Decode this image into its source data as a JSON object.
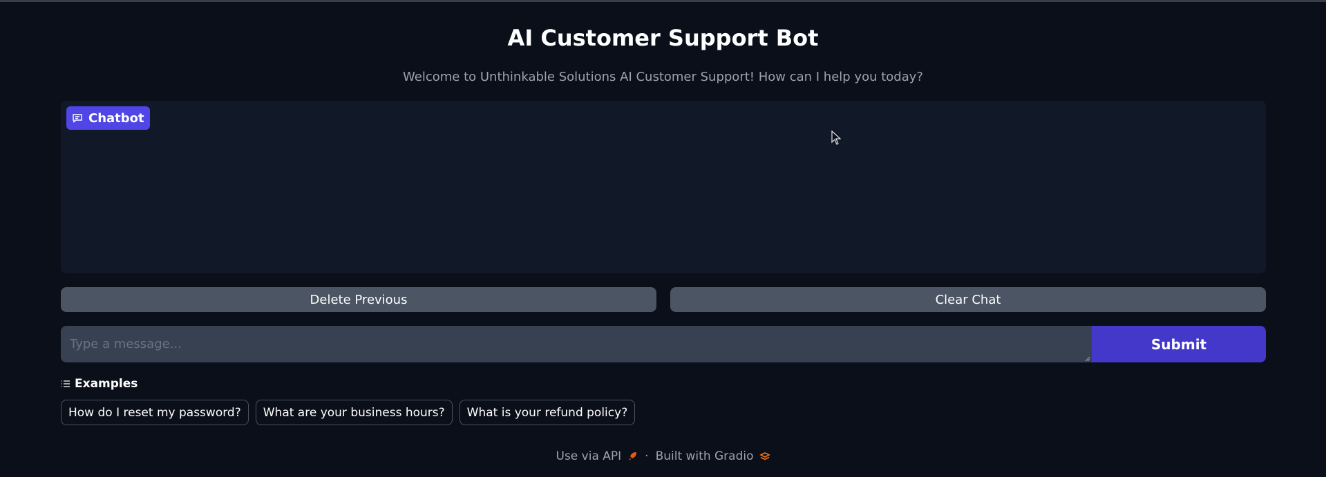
{
  "header": {
    "title": "AI Customer Support Bot",
    "subtitle": "Welcome to Unthinkable Solutions AI Customer Support! How can I help you today?"
  },
  "chatbot": {
    "label": "Chatbot",
    "icon": "chat-icon",
    "messages": []
  },
  "actions": {
    "delete_label": "Delete Previous",
    "clear_label": "Clear Chat"
  },
  "input": {
    "placeholder": "Type a message...",
    "value": "",
    "submit_label": "Submit"
  },
  "examples": {
    "label": "Examples",
    "icon": "list-icon",
    "items": [
      "How do I reset my password?",
      "What are your business hours?",
      "What is your refund policy?"
    ]
  },
  "footer": {
    "api_label": "Use via API",
    "api_icon": "rocket-icon",
    "separator": "·",
    "built_label": "Built with Gradio",
    "built_icon": "gradio-logo-icon"
  },
  "colors": {
    "background": "#0b0f19",
    "panel": "#111827",
    "accent": "#4f46e5",
    "submit": "#4338ca",
    "secondary_button": "#4b5563",
    "input": "#374151"
  }
}
